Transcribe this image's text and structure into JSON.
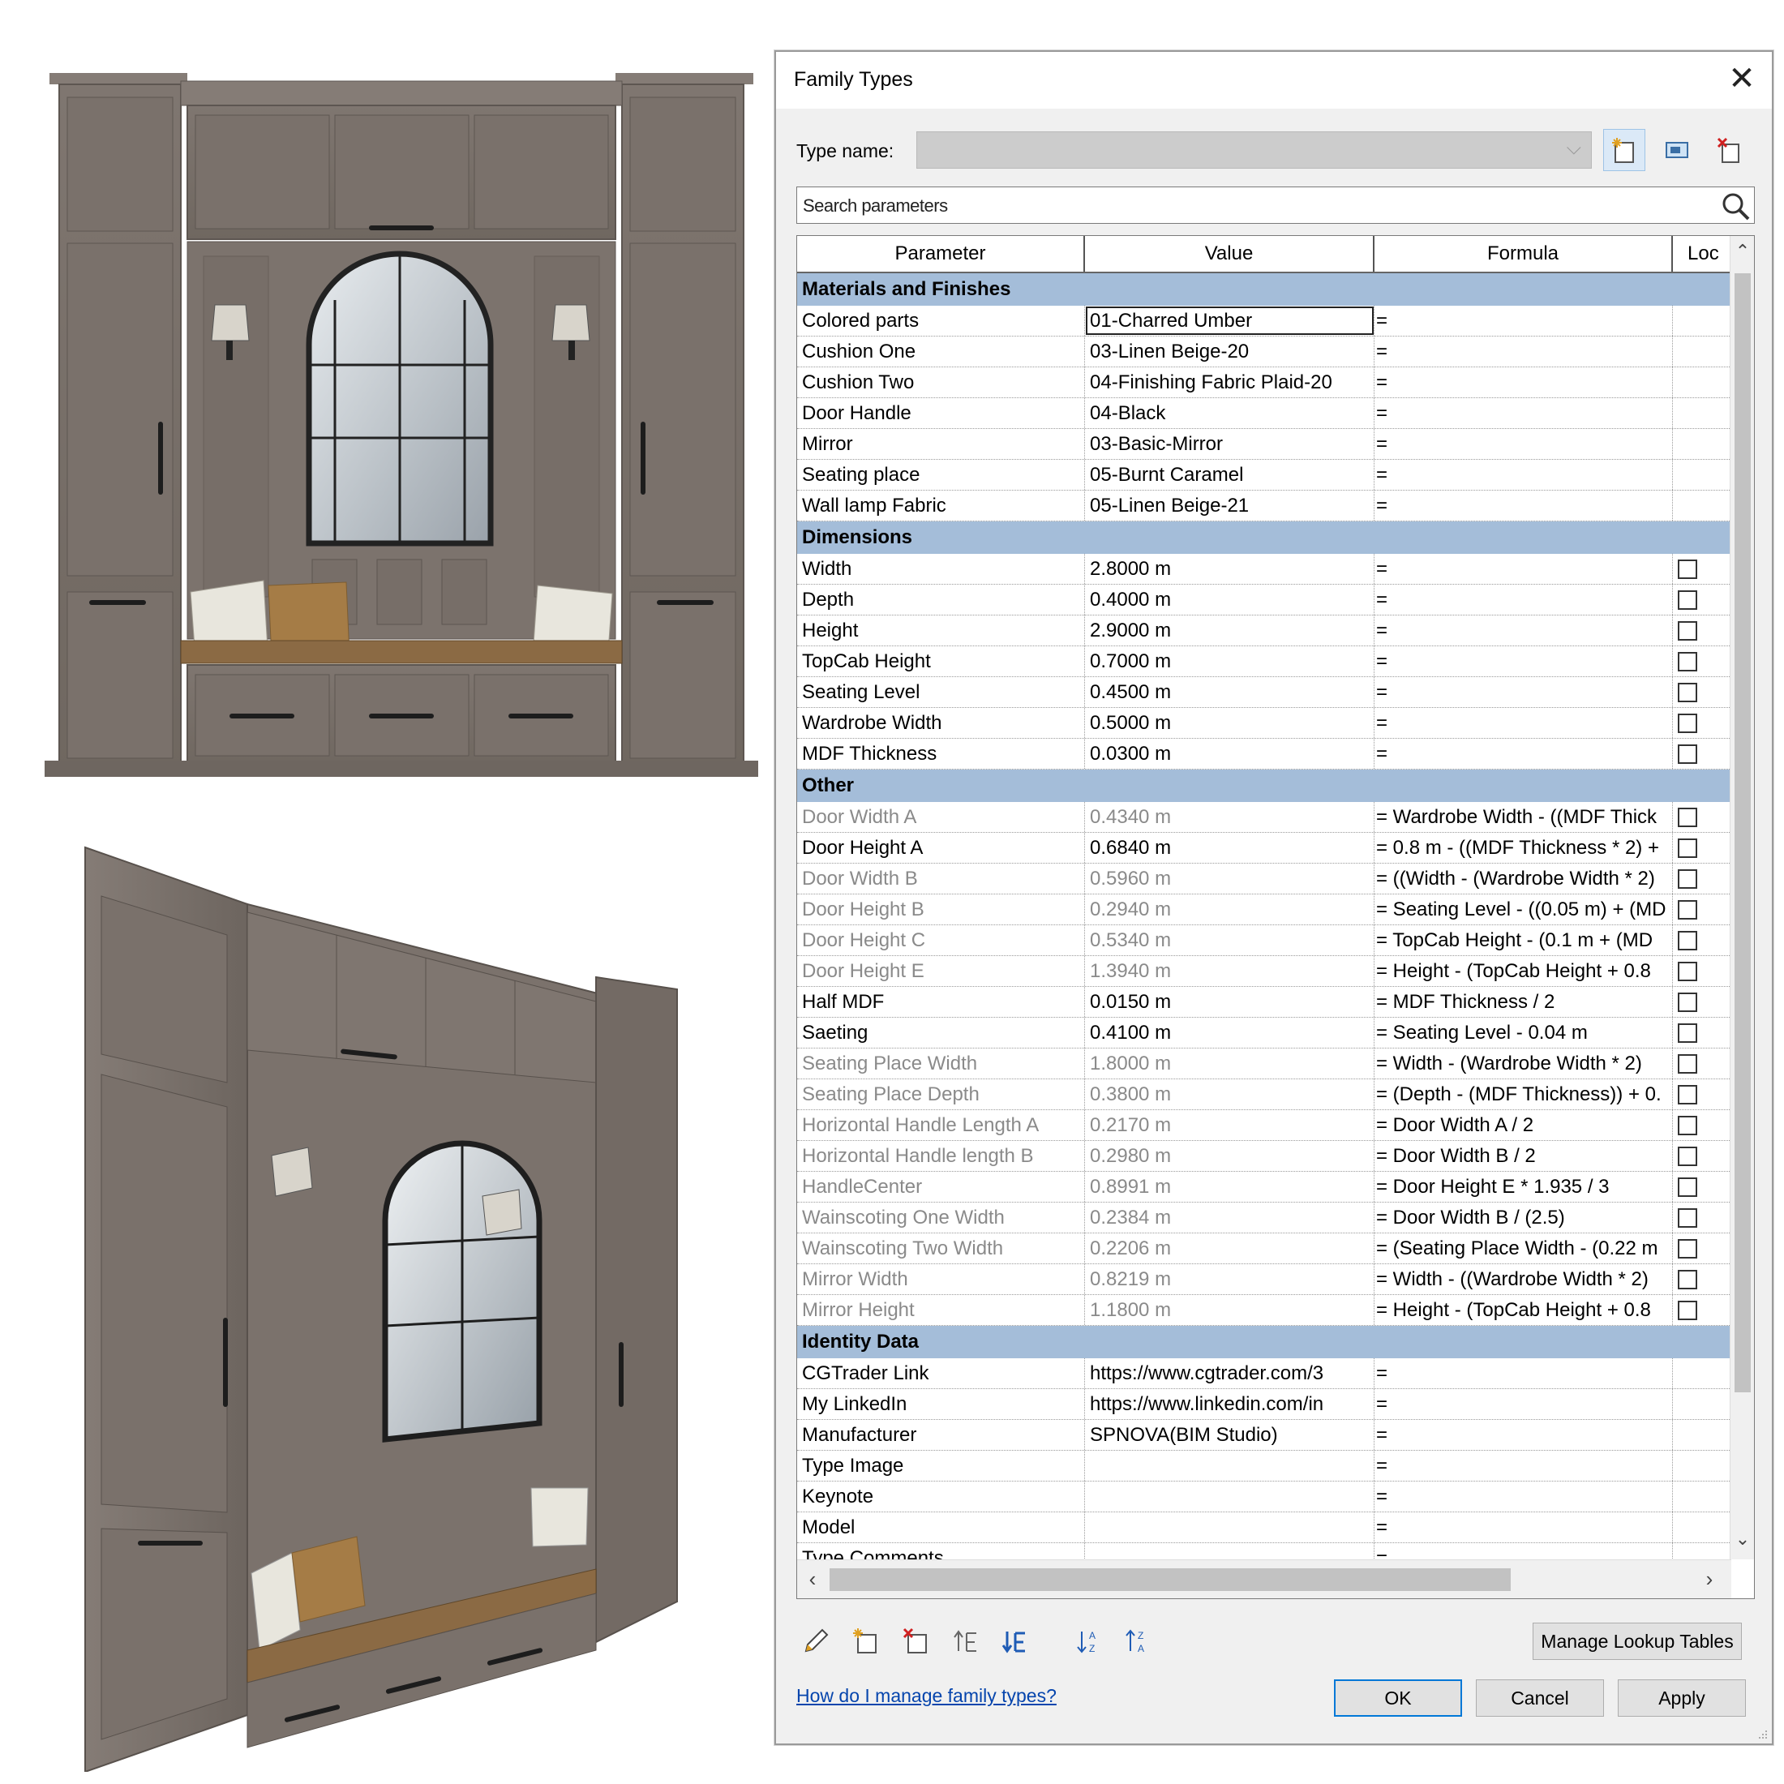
{
  "dialog": {
    "title": "Family Types",
    "close_glyph": "✕",
    "type_name_label": "Type name:",
    "type_name_value": "",
    "search_placeholder": "Search parameters",
    "columns": {
      "parameter": "Parameter",
      "value": "Value",
      "formula": "Formula",
      "lock": "Loc"
    },
    "sections": [
      {
        "title": "Materials and Finishes",
        "rows": [
          {
            "param": "Colored parts",
            "value": "01-Charred Umber",
            "formula": "=",
            "lock": null,
            "grey": false,
            "editing": true
          },
          {
            "param": "Cushion One",
            "value": "03-Linen Beige-20",
            "formula": "=",
            "lock": null,
            "grey": false
          },
          {
            "param": "Cushion Two",
            "value": "04-Finishing Fabric Plaid-20",
            "formula": "=",
            "lock": null,
            "grey": false
          },
          {
            "param": "Door Handle",
            "value": "04-Black",
            "formula": "=",
            "lock": null,
            "grey": false
          },
          {
            "param": "Mirror",
            "value": "03-Basic-Mirror",
            "formula": "=",
            "lock": null,
            "grey": false
          },
          {
            "param": "Seating place",
            "value": "05-Burnt Caramel",
            "formula": "=",
            "lock": null,
            "grey": false
          },
          {
            "param": "Wall lamp Fabric",
            "value": "05-Linen Beige-21",
            "formula": "=",
            "lock": null,
            "grey": false
          }
        ]
      },
      {
        "title": "Dimensions",
        "rows": [
          {
            "param": "Width",
            "value": "2.8000 m",
            "formula": "=",
            "lock": false,
            "grey": false
          },
          {
            "param": "Depth",
            "value": "0.4000 m",
            "formula": "=",
            "lock": false,
            "grey": false
          },
          {
            "param": "Height",
            "value": "2.9000 m",
            "formula": "=",
            "lock": false,
            "grey": false
          },
          {
            "param": "TopCab Height",
            "value": "0.7000 m",
            "formula": "=",
            "lock": false,
            "grey": false
          },
          {
            "param": "Seating Level",
            "value": "0.4500 m",
            "formula": "=",
            "lock": false,
            "grey": false
          },
          {
            "param": "Wardrobe Width",
            "value": "0.5000 m",
            "formula": "=",
            "lock": false,
            "grey": false
          },
          {
            "param": "MDF Thickness",
            "value": "0.0300 m",
            "formula": "=",
            "lock": false,
            "grey": false
          }
        ]
      },
      {
        "title": "Other",
        "rows": [
          {
            "param": "Door Width A",
            "value": "0.4340 m",
            "formula": "= Wardrobe Width - ((MDF Thick",
            "lock": false,
            "grey": true
          },
          {
            "param": "Door Height A",
            "value": "0.6840 m",
            "formula": "= 0.8 m - ((MDF Thickness * 2) +",
            "lock": false,
            "grey": false
          },
          {
            "param": "Door Width B",
            "value": "0.5960 m",
            "formula": "= ((Width - (Wardrobe Width * 2)",
            "lock": false,
            "grey": true
          },
          {
            "param": "Door Height B",
            "value": "0.2940 m",
            "formula": "= Seating Level - ((0.05 m) + (MD",
            "lock": false,
            "grey": true
          },
          {
            "param": "Door Height C",
            "value": "0.5340 m",
            "formula": "= TopCab Height - (0.1 m + (MD",
            "lock": false,
            "grey": true
          },
          {
            "param": "Door Height E",
            "value": "1.3940 m",
            "formula": "= Height - (TopCab Height + 0.8",
            "lock": false,
            "grey": true
          },
          {
            "param": "Half MDF",
            "value": "0.0150 m",
            "formula": "= MDF Thickness / 2",
            "lock": false,
            "grey": false
          },
          {
            "param": "Saeting",
            "value": "0.4100 m",
            "formula": "= Seating Level - 0.04 m",
            "lock": false,
            "grey": false
          },
          {
            "param": "Seating Place Width",
            "value": "1.8000 m",
            "formula": "= Width - (Wardrobe Width * 2)",
            "lock": false,
            "grey": true
          },
          {
            "param": "Seating Place Depth",
            "value": "0.3800 m",
            "formula": "= (Depth - (MDF Thickness)) + 0.",
            "lock": false,
            "grey": true
          },
          {
            "param": "Horizontal Handle Length A",
            "value": "0.2170 m",
            "formula": "= Door Width A / 2",
            "lock": false,
            "grey": true
          },
          {
            "param": "Horizontal Handle length B",
            "value": "0.2980 m",
            "formula": "= Door Width B / 2",
            "lock": false,
            "grey": true
          },
          {
            "param": "HandleCenter",
            "value": "0.8991 m",
            "formula": "= Door Height E * 1.935 / 3",
            "lock": false,
            "grey": true
          },
          {
            "param": "Wainscoting One Width",
            "value": "0.2384 m",
            "formula": "= Door Width B / (2.5)",
            "lock": false,
            "grey": true
          },
          {
            "param": "Wainscoting Two Width",
            "value": "0.2206 m",
            "formula": "= (Seating Place Width - (0.22 m",
            "lock": false,
            "grey": true
          },
          {
            "param": "Mirror Width",
            "value": "0.8219 m",
            "formula": "= Width - ((Wardrobe Width * 2)",
            "lock": false,
            "grey": true
          },
          {
            "param": "Mirror Height",
            "value": "1.1800 m",
            "formula": "= Height - (TopCab Height + 0.8",
            "lock": false,
            "grey": true
          }
        ]
      },
      {
        "title": "Identity Data",
        "rows": [
          {
            "param": "CGTrader Link",
            "value": "https://www.cgtrader.com/3",
            "formula": "=",
            "lock": null,
            "grey": false
          },
          {
            "param": "My LinkedIn",
            "value": "https://www.linkedin.com/in",
            "formula": "=",
            "lock": null,
            "grey": false
          },
          {
            "param": "Manufacturer",
            "value": "SPNOVA(BIM Studio)",
            "formula": "=",
            "lock": null,
            "grey": false
          },
          {
            "param": "Type Image",
            "value": "",
            "formula": "=",
            "lock": null,
            "grey": false
          },
          {
            "param": "Keynote",
            "value": "",
            "formula": "=",
            "lock": null,
            "grey": false
          },
          {
            "param": "Model",
            "value": "",
            "formula": "=",
            "lock": null,
            "grey": false
          },
          {
            "param": "Type Comments",
            "value": "",
            "formula": "=",
            "lock": null,
            "grey": false
          }
        ]
      }
    ],
    "buttons": {
      "manage_lookup": "Manage Lookup Tables",
      "ok": "OK",
      "cancel": "Cancel",
      "apply": "Apply"
    },
    "help_link": "How do I manage family types?",
    "icons": [
      "new-type-icon",
      "rename-type-icon",
      "delete-type-icon",
      "edit-parameter-icon",
      "new-parameter-icon",
      "delete-parameter-icon",
      "move-up-icon",
      "move-down-icon",
      "sort-ascending-icon",
      "sort-descending-icon",
      "search-icon"
    ],
    "colors": {
      "section_header": "#a4bdd9",
      "dialog_bg": "#f0f0f0",
      "link": "#0645ad",
      "ok_border": "#0078d7"
    }
  },
  "renders": {
    "cabinet_color": "#786f69",
    "cushion_color": "#a57c46",
    "seat_color": "#8b6a44"
  }
}
